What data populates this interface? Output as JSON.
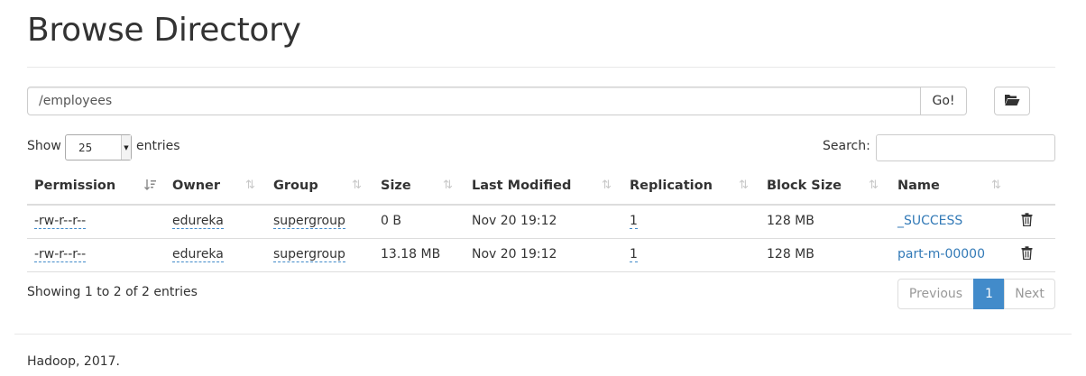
{
  "page": {
    "title": "Browse Directory"
  },
  "path_bar": {
    "value": "/employees",
    "go_label": "Go!"
  },
  "icons": {
    "folder": "folder-open-icon",
    "delete": "trash-icon",
    "sort": "sort-arrows-icon"
  },
  "length_menu": {
    "show_label": "Show",
    "selected": "25",
    "entries_label": "entries"
  },
  "search": {
    "label": "Search:",
    "value": ""
  },
  "table": {
    "columns": [
      "Permission",
      "Owner",
      "Group",
      "Size",
      "Last Modified",
      "Replication",
      "Block Size",
      "Name"
    ],
    "rows": [
      {
        "permission": "-rw-r--r--",
        "owner": "edureka",
        "group": "supergroup",
        "size": "0 B",
        "modified": "Nov 20 19:12",
        "replication": "1",
        "block_size": "128 MB",
        "name": "_SUCCESS"
      },
      {
        "permission": "-rw-r--r--",
        "owner": "edureka",
        "group": "supergroup",
        "size": "13.18 MB",
        "modified": "Nov 20 19:12",
        "replication": "1",
        "block_size": "128 MB",
        "name": "part-m-00000"
      }
    ]
  },
  "table_info": "Showing 1 to 2 of 2 entries",
  "pagination": {
    "previous": "Previous",
    "current": "1",
    "next": "Next"
  },
  "footer": "Hadoop, 2017.",
  "colors": {
    "accent": "#428bca",
    "link": "#337ab7"
  }
}
